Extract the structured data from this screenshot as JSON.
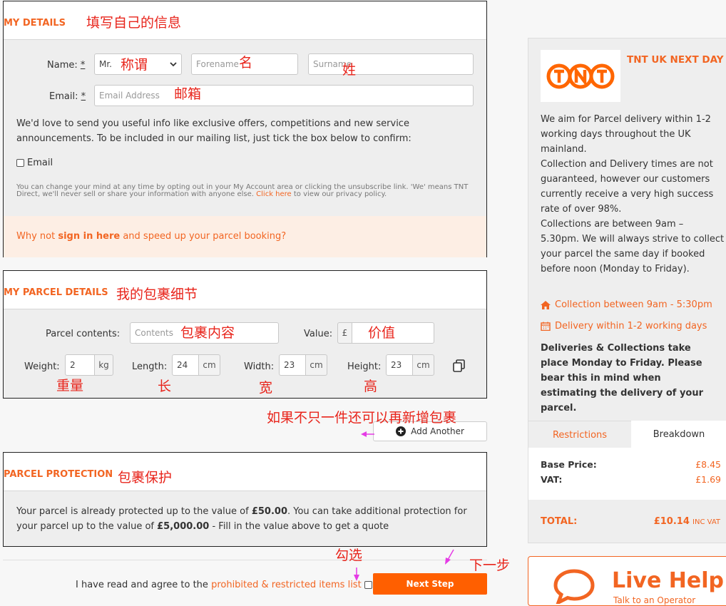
{
  "my_details": {
    "title": "MY DETAILS",
    "name_label": "Name:",
    "required_mark": "*",
    "title_select_value": "Mr.",
    "forename_placeholder": "Forename",
    "surname_placeholder": "Surname",
    "email_label": "Email:",
    "email_placeholder": "Email Address",
    "mailing_text": "We'd love to send you useful info like exclusive offers, competitions and new service announcements. To be included in our mailing list, just tick the box below to confirm:",
    "email_checkbox_label": "Email",
    "disclaimer": "You can change your mind at any time by opting out in your My Account area or clicking the unsubscribe link. 'We' means TNT Direct, we'll never sell or share your information with anyone else.",
    "click_here": "Click here",
    "disclaimer_end": "to view our privacy policy.",
    "signin_prefix": "Why not",
    "signin_link": "sign in here",
    "signin_suffix": "and speed up your parcel booking?"
  },
  "parcel_details": {
    "title": "MY PARCEL DETAILS",
    "contents_label": "Parcel contents:",
    "contents_placeholder": "Contents",
    "value_label": "Value:",
    "currency": "£",
    "weight_label": "Weight:",
    "weight_value": "2",
    "weight_unit": "kg",
    "length_label": "Length:",
    "length_value": "24",
    "length_unit": "cm",
    "width_label": "Width:",
    "width_value": "23",
    "width_unit": "cm",
    "height_label": "Height:",
    "height_value": "23",
    "height_unit": "cm",
    "add_another": "Add Another"
  },
  "protection": {
    "title": "PARCEL PROTECTION",
    "text_1": "Your parcel is already protected up to the value of",
    "amount_1": "£50.00",
    "text_2": ". You can take additional protection for your parcel up to the value of",
    "amount_2": "£5,000.00",
    "text_3": "- Fill in the value above to get a quote"
  },
  "footer": {
    "agree_text": "I have read and agree to the",
    "agree_link": "prohibited & restricted items list",
    "next_button": "Next Step"
  },
  "sidebar": {
    "service_name": "TNT UK NEXT DAY",
    "logo_text": "TNT",
    "description_1": "We aim for Parcel delivery within 1-2 working days throughout the UK mainland.",
    "description_2": "Collection and Delivery times are not guaranteed, however our customers currently receive a very high success rate of over 98%.",
    "description_3": "Collections are between 9am – 5.30pm. We will always strive to collect your parcel the same day if booked before noon (Monday to Friday).",
    "collection": "Collection between 9am - 5:30pm",
    "delivery": "Delivery within 1-2 working days",
    "notice": "Deliveries & Collections take place Monday to Friday. Please bear this in mind when estimating the delivery of your parcel.",
    "tab_restrictions": "Restrictions",
    "tab_breakdown": "Breakdown",
    "base_price_label": "Base Price:",
    "base_price": "£8.45",
    "vat_label": "VAT:",
    "vat": "£1.69",
    "total_label": "TOTAL:",
    "total": "£10.14",
    "total_suffix": "INC VAT"
  },
  "live_help": {
    "title": "Live Help",
    "subtitle": "Talk to an Operator"
  },
  "annotations": {
    "fill_info": "填写自己的信息",
    "salutation": "称谓",
    "forename": "名",
    "surname": "姓",
    "email": "邮箱",
    "parcel_details": "我的包裹细节",
    "contents": "包裹内容",
    "value": "价值",
    "weight": "重量",
    "length": "长",
    "width": "宽",
    "height": "高",
    "add_more": "如果不只一件还可以再新增包裹",
    "protection": "包裹保护",
    "tick": "勾选",
    "next": "下一步"
  },
  "colors": {
    "accent": "#f26522",
    "annotation": "#e8241b",
    "arrow": "#e53be5",
    "panel": "#eeeeee"
  }
}
